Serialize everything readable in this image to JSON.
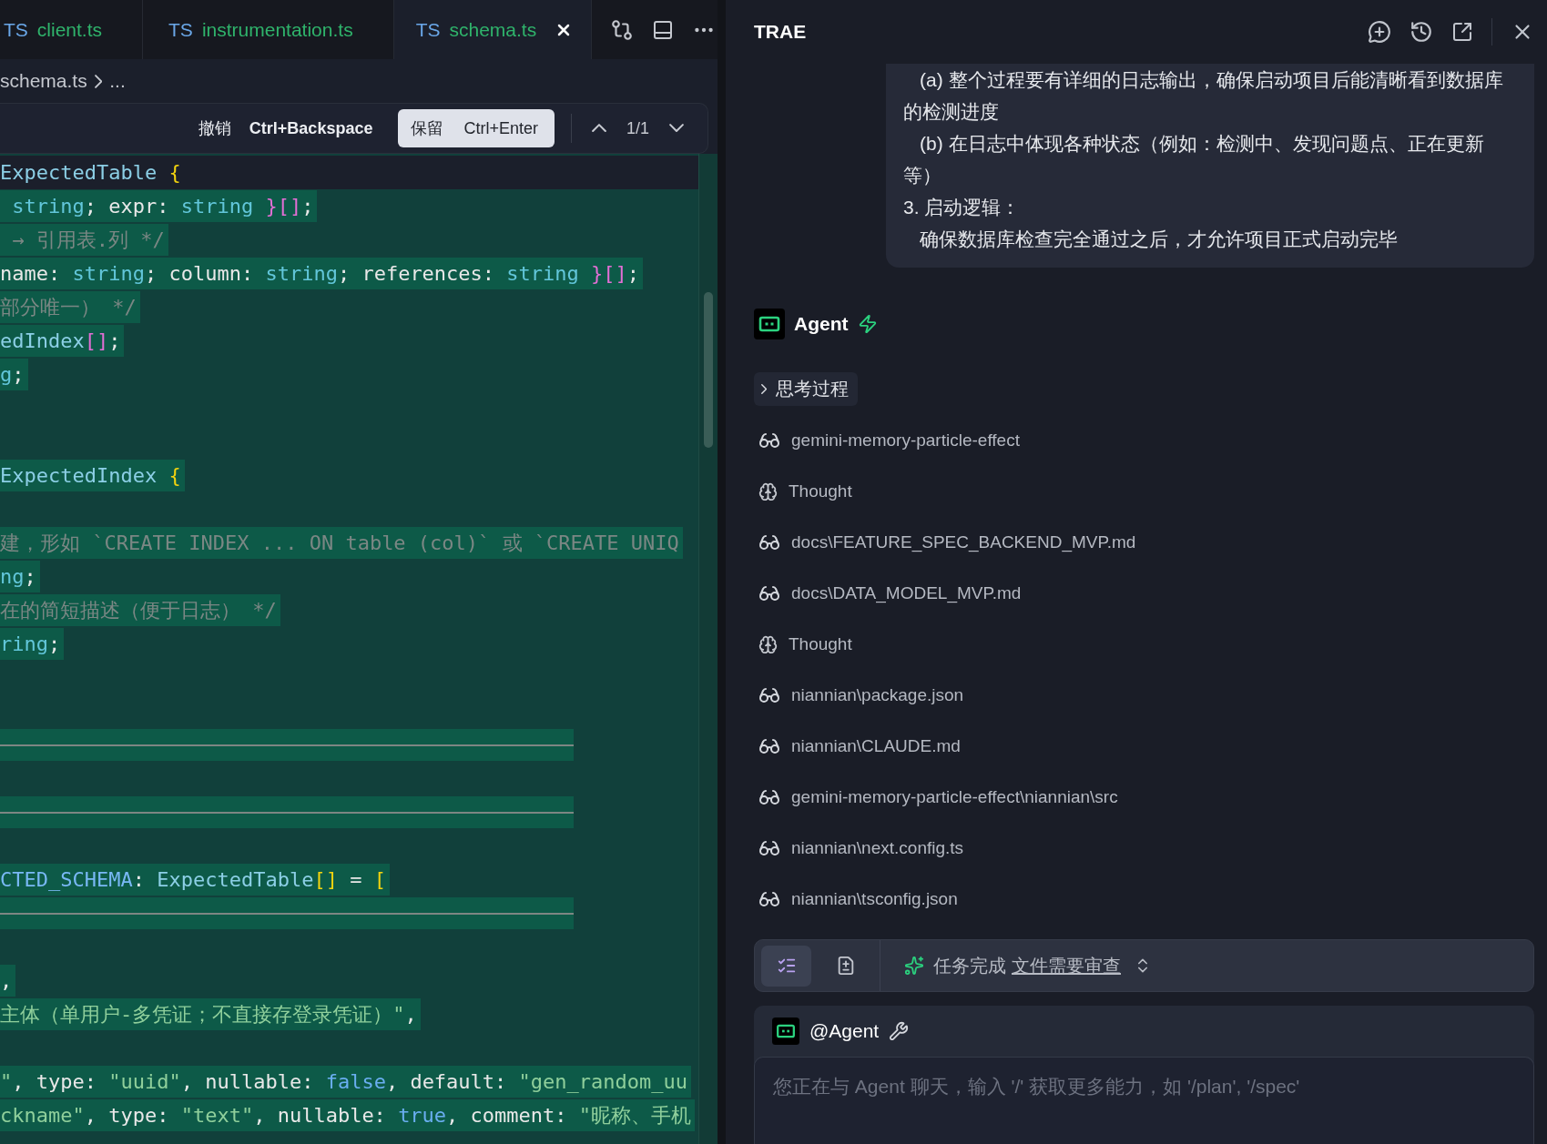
{
  "editor": {
    "tabs": [
      {
        "lang": "TS",
        "label": "client.ts",
        "selected": false
      },
      {
        "lang": "TS",
        "label": "instrumentation.ts",
        "selected": false
      },
      {
        "lang": "TS",
        "label": "schema.ts",
        "selected": true
      }
    ],
    "breadcrumb": [
      "schema.ts",
      "..."
    ],
    "diff_toolbar": {
      "discard": {
        "label": "撤销",
        "shortcut": "Ctrl+Backspace"
      },
      "keep": {
        "label": "保留",
        "shortcut": "Ctrl+Enter"
      },
      "counter": "1/1"
    },
    "lines": [
      {
        "kind": "code",
        "changed": false,
        "tokens": [
          {
            "kind": "type",
            "text": "ExpectedTable"
          },
          {
            "kind": "brace",
            "text": " {"
          }
        ]
      },
      {
        "kind": "code",
        "changed": true,
        "tokens": [
          {
            "kind": "primitive",
            "text": " string"
          },
          {
            "kind": "plain",
            "text": "; expr: "
          },
          {
            "kind": "primitive",
            "text": "string"
          },
          {
            "kind": "bracket",
            "text": " }[]"
          },
          {
            "kind": "plain",
            "text": ";"
          }
        ]
      },
      {
        "kind": "code",
        "changed": true,
        "tokens": [
          {
            "kind": "comment",
            "text": " → 引用表.列 */"
          }
        ]
      },
      {
        "kind": "code",
        "changed": true,
        "tokens": [
          {
            "kind": "plain",
            "text": "name: "
          },
          {
            "kind": "primitive",
            "text": "string"
          },
          {
            "kind": "plain",
            "text": "; column: "
          },
          {
            "kind": "primitive",
            "text": "string"
          },
          {
            "kind": "plain",
            "text": "; references: "
          },
          {
            "kind": "primitive",
            "text": "string"
          },
          {
            "kind": "bracket",
            "text": " }[]"
          },
          {
            "kind": "plain",
            "text": ";"
          }
        ]
      },
      {
        "kind": "code",
        "changed": true,
        "tokens": [
          {
            "kind": "comment",
            "text": "部分唯一） */"
          }
        ]
      },
      {
        "kind": "code",
        "changed": true,
        "tokens": [
          {
            "kind": "type",
            "text": "edIndex"
          },
          {
            "kind": "bracket",
            "text": "[]"
          },
          {
            "kind": "plain",
            "text": ";"
          }
        ]
      },
      {
        "kind": "code",
        "changed": true,
        "tokens": [
          {
            "kind": "primitive",
            "text": "g"
          },
          {
            "kind": "plain",
            "text": ";"
          }
        ]
      },
      {
        "kind": "blank"
      },
      {
        "kind": "blank"
      },
      {
        "kind": "code",
        "changed": true,
        "tokens": [
          {
            "kind": "type",
            "text": "ExpectedIndex"
          },
          {
            "kind": "brace",
            "text": " {"
          }
        ]
      },
      {
        "kind": "blank"
      },
      {
        "kind": "code",
        "changed": true,
        "tokens": [
          {
            "kind": "comment",
            "text": "建，形如 `CREATE INDEX ... ON table (col)` 或 `CREATE UNIQ"
          }
        ]
      },
      {
        "kind": "code",
        "changed": true,
        "tokens": [
          {
            "kind": "primitive",
            "text": "ng"
          },
          {
            "kind": "plain",
            "text": ";"
          }
        ]
      },
      {
        "kind": "code",
        "changed": true,
        "tokens": [
          {
            "kind": "comment",
            "text": "在的简短描述（便于日志） */"
          }
        ]
      },
      {
        "kind": "code",
        "changed": true,
        "tokens": [
          {
            "kind": "primitive",
            "text": "ring"
          },
          {
            "kind": "plain",
            "text": ";"
          }
        ]
      },
      {
        "kind": "blank"
      },
      {
        "kind": "blank"
      },
      {
        "kind": "removed"
      },
      {
        "kind": "blank"
      },
      {
        "kind": "removed"
      },
      {
        "kind": "blank"
      },
      {
        "kind": "code",
        "changed": true,
        "tokens": [
          {
            "kind": "constant",
            "text": "CTED_SCHEMA"
          },
          {
            "kind": "plain",
            "text": ": "
          },
          {
            "kind": "type",
            "text": "ExpectedTable"
          },
          {
            "kind": "brace",
            "text": "[]"
          },
          {
            "kind": "plain",
            "text": " = "
          },
          {
            "kind": "brace",
            "text": "["
          }
        ]
      },
      {
        "kind": "removed"
      },
      {
        "kind": "blank"
      },
      {
        "kind": "code",
        "changed": true,
        "tokens": [
          {
            "kind": "plain",
            "text": ","
          }
        ]
      },
      {
        "kind": "code",
        "changed": true,
        "tokens": [
          {
            "kind": "string",
            "text": "主体（单用户-多凭证；不直接存登录凭证）\""
          },
          {
            "kind": "plain",
            "text": ","
          }
        ]
      },
      {
        "kind": "blank"
      },
      {
        "kind": "code",
        "changed": true,
        "tokens": [
          {
            "kind": "string",
            "text": "\""
          },
          {
            "kind": "plain",
            "text": ", type: "
          },
          {
            "kind": "string",
            "text": "\"uuid\""
          },
          {
            "kind": "plain",
            "text": ", nullable: "
          },
          {
            "kind": "keyword",
            "text": "false"
          },
          {
            "kind": "plain",
            "text": ", default: "
          },
          {
            "kind": "string",
            "text": "\"gen_random_uu"
          }
        ]
      },
      {
        "kind": "code",
        "changed": true,
        "tokens": [
          {
            "kind": "string",
            "text": "ckname\""
          },
          {
            "kind": "plain",
            "text": ", type: "
          },
          {
            "kind": "string",
            "text": "\"text\""
          },
          {
            "kind": "plain",
            "text": ", nullable: "
          },
          {
            "kind": "keyword",
            "text": "true"
          },
          {
            "kind": "plain",
            "text": ", comment: "
          },
          {
            "kind": "string",
            "text": "\"昵称、手机"
          }
        ]
      }
    ]
  },
  "panel": {
    "title": "TRAE",
    "message": [
      {
        "text": "(a) 整个过程要有详细的日志输出，确保启动项目后能清晰看到数据库的检测进度",
        "indented": true
      },
      {
        "text": "(b) 在日志中体现各种状态（例如：检测中、发现问题点、正在更新等）",
        "indented": true
      },
      {
        "text": "3. 启动逻辑：",
        "indented": false
      },
      {
        "text": "确保数据库检查完全通过之后，才允许项目正式启动完毕",
        "indented": true
      }
    ],
    "agent": {
      "name": "Agent"
    },
    "thinking": {
      "label": "思考过程",
      "expanded": false
    },
    "steps": [
      {
        "kind": "read",
        "text": "gemini-memory-particle-effect"
      },
      {
        "kind": "thought",
        "text": "Thought"
      },
      {
        "kind": "read",
        "text": "docs\\FEATURE_SPEC_BACKEND_MVP.md"
      },
      {
        "kind": "read",
        "text": "docs\\DATA_MODEL_MVP.md"
      },
      {
        "kind": "thought",
        "text": "Thought"
      },
      {
        "kind": "read",
        "text": "niannian\\package.json"
      },
      {
        "kind": "read",
        "text": "niannian\\CLAUDE.md"
      },
      {
        "kind": "read",
        "text": "gemini-memory-particle-effect\\niannian\\src"
      },
      {
        "kind": "read",
        "text": "niannian\\next.config.ts"
      },
      {
        "kind": "read",
        "text": "niannian\\tsconfig.json"
      }
    ],
    "status": {
      "views": [
        {
          "kind": "todo",
          "selected": true
        },
        {
          "kind": "changes",
          "selected": false
        }
      ],
      "text": "任务完成",
      "link": "文件需要审查"
    },
    "composer": {
      "mention": "@Agent",
      "placeholder": "您正在与 Agent 聊天，输入 '/' 获取更多能力，如 '/plan', '/spec'"
    }
  }
}
